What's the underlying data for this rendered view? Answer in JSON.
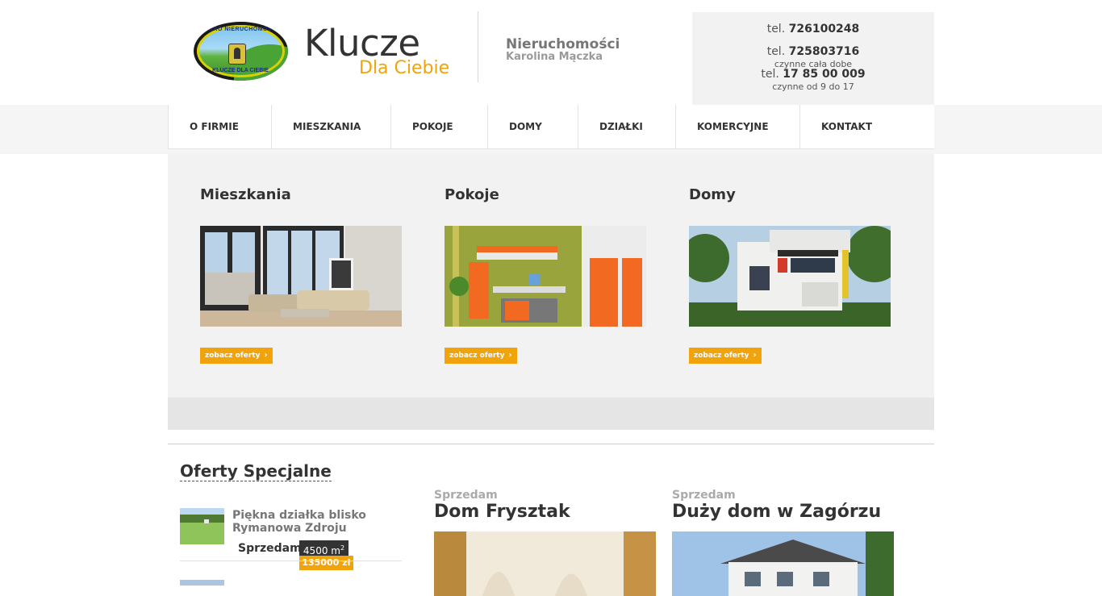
{
  "header": {
    "logo_text_top": "BIURO NIERUCHOMOŚCI",
    "logo_text_bottom": "KLUCZE DLA CIEBIE",
    "brand_main": "Klucze",
    "brand_sub": "Dla Ciebie",
    "company_title": "Nieruchomości",
    "company_owner": "Karolina Mączka"
  },
  "contact": {
    "phone1_label": "tel.",
    "phone1": "726100248",
    "phone2_label": "tel.",
    "phone2": "725803716",
    "phone2_hours": "czynne cała dobe",
    "phone3_label": "tel.",
    "phone3": "17 85 00 009",
    "phone3_hours": "czynne od 9 do 17"
  },
  "nav": {
    "items": [
      "O FIRMIE",
      "MIESZKANIA",
      "POKOJE",
      "DOMY",
      "DZIAŁKI",
      "KOMERCYJNE",
      "KONTAKT"
    ]
  },
  "categories": [
    {
      "title": "Mieszkania",
      "button": "zobacz oferty"
    },
    {
      "title": "Pokoje",
      "button": "zobacz oferty"
    },
    {
      "title": "Domy",
      "button": "zobacz oferty"
    }
  ],
  "special": {
    "heading": "Oferty Specjalne",
    "items": [
      {
        "name": "Piękna działka blisko Rymanowa Zdroju",
        "type": "Sprzedam",
        "area": "4500 m",
        "area_unit_sup": "2",
        "price": "135000 zł"
      }
    ]
  },
  "offers": [
    {
      "kind": "Sprzedam",
      "title": "Dom Frysztak"
    },
    {
      "kind": "Sprzedam",
      "title": "Duży dom w Zagórzu"
    }
  ],
  "colors": {
    "accent": "#f0a30a",
    "text": "#333333",
    "panel": "#f2f2f2"
  }
}
